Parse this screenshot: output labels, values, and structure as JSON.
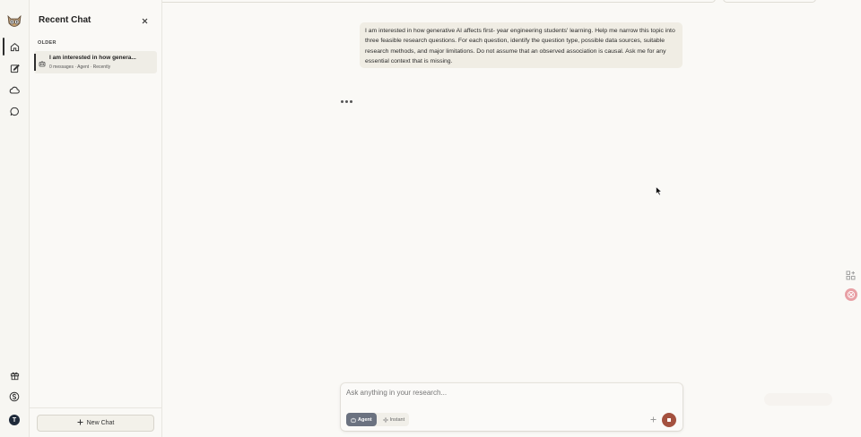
{
  "sidebar": {
    "title": "Recent Chat",
    "section_label": "OLDER",
    "chats": [
      {
        "title": "I am interested in how genera...",
        "meta": "0 messages · Agent · Recently"
      }
    ],
    "new_chat_label": "New Chat"
  },
  "rail": {
    "items": [
      "home-icon",
      "edit-icon",
      "cloud-icon",
      "chat-bubble-icon"
    ],
    "bottom_items": [
      "gift-icon",
      "dollar-icon"
    ],
    "avatar_initial": "T"
  },
  "conversation": {
    "user_message": "I am interested in how generative AI affects first- year engineering students' learning. Help me narrow this topic into three feasible research questions. For each question, identify the question type, possible data sources, suitable research methods, and major limitations. Do not assume that an observed association is causal. Ask me for any essential context that is missing."
  },
  "composer": {
    "placeholder": "Ask anything in your research...",
    "modes": [
      {
        "label": "Agent",
        "active": true
      },
      {
        "label": "Instant",
        "active": false
      }
    ],
    "stop_color": "#a4513f"
  },
  "colors": {
    "background": "#faf9f6",
    "message_bubble": "#f0ede4",
    "active_mode": "#6b7280"
  }
}
